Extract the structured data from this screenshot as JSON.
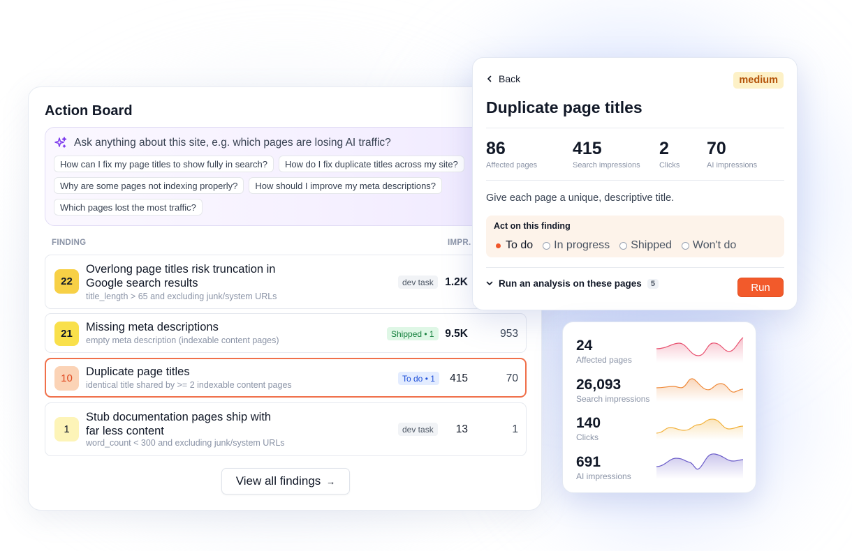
{
  "board": {
    "title": "Action Board",
    "ask": {
      "placeholder": "Ask anything about this site, e.g. which pages are losing AI traffic?",
      "suggestions": [
        "How can I fix my page titles to show fully in search?",
        "How do I fix duplicate titles across my site?",
        "Why are some pages not indexing properly?",
        "How should I improve my meta descriptions?",
        "Which pages lost the most traffic?"
      ]
    },
    "columns": {
      "finding": "FINDING",
      "impr": "IMPR."
    },
    "findings": [
      {
        "score": "22",
        "title_line1": "Overlong page titles risk truncation in",
        "title_line2": "Google search results",
        "subtitle": "title_length > 65 and excluding junk/system URLs",
        "tag": "dev task",
        "impressions": "1.2K",
        "second": ""
      },
      {
        "score": "21",
        "title_line1": "Missing meta descriptions",
        "subtitle": "empty meta description (indexable content pages)",
        "tag": "Shipped • 1",
        "impressions": "9.5K",
        "second": "953"
      },
      {
        "score": "10",
        "title_line1": "Duplicate page titles",
        "subtitle": "identical title shared by >= 2 indexable content pages",
        "tag": "To do • 1",
        "impressions": "415",
        "second": "70"
      },
      {
        "score": "1",
        "title_line1": "Stub documentation pages ship with",
        "title_line2": "far less content",
        "subtitle": "word_count < 300 and excluding junk/system URLs",
        "tag": "dev task",
        "impressions": "13",
        "second": "1"
      }
    ],
    "view_all": "View all findings",
    "view_all_arrow": "→"
  },
  "detail": {
    "back": "Back",
    "severity": "medium",
    "title": "Duplicate page titles",
    "stats": [
      {
        "value": "86",
        "label": "Affected pages"
      },
      {
        "value": "415",
        "label": "Search impressions"
      },
      {
        "value": "2",
        "label": "Clicks"
      },
      {
        "value": "70",
        "label": "AI impressions"
      }
    ],
    "advice": "Give each page a unique, descriptive title.",
    "act_label": "Act on this finding",
    "statuses": [
      "To do",
      "In progress",
      "Shipped",
      "Won't do"
    ],
    "selected_status": "To do",
    "run_label": "Run an analysis on these pages",
    "run_count": "5",
    "run_button": "Run"
  },
  "metrics": [
    {
      "value": "24",
      "label": "Affected pages",
      "color": "#e8506f"
    },
    {
      "value": "26,093",
      "label": "Search impressions",
      "color": "#ef8a3a"
    },
    {
      "value": "140",
      "label": "Clicks",
      "color": "#f2b13a"
    },
    {
      "value": "691",
      "label": "AI impressions",
      "color": "#6b5cc9"
    }
  ],
  "colors": {
    "accent_orange": "#f25a2b",
    "selected_border": "#f0704a",
    "sev_22": "#f7d046",
    "sev_21": "#f9e04b",
    "sev_10": "#fbd3b6",
    "sev_1": "#fdf4b8"
  }
}
